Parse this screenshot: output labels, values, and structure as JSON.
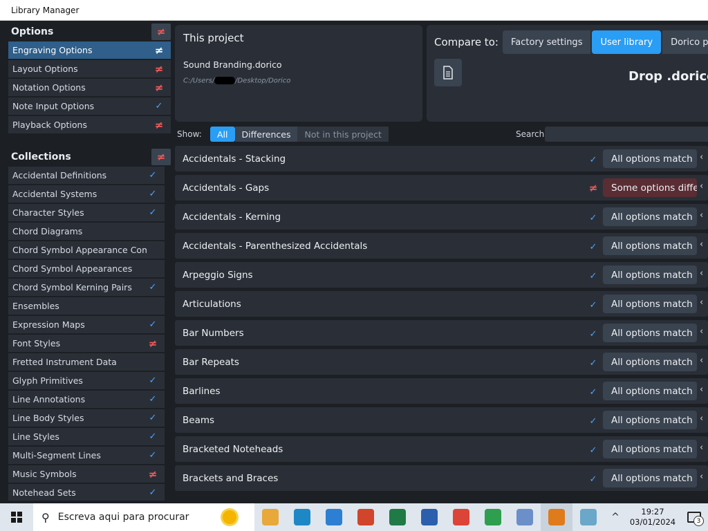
{
  "window": {
    "title": "Library Manager"
  },
  "options_section": {
    "title": "Options",
    "items": [
      {
        "label": "Engraving Options",
        "status": "differ"
      },
      {
        "label": "Layout Options",
        "status": "differ"
      },
      {
        "label": "Notation Options",
        "status": "differ"
      },
      {
        "label": "Note Input Options",
        "status": "match"
      },
      {
        "label": "Playback Options",
        "status": "differ"
      }
    ]
  },
  "collections_section": {
    "title": "Collections",
    "items": [
      {
        "label": "Accidental Definitions",
        "status": "match"
      },
      {
        "label": "Accidental Systems",
        "status": "match"
      },
      {
        "label": "Character Styles",
        "status": "match"
      },
      {
        "label": "Chord Diagrams",
        "status": "none"
      },
      {
        "label": "Chord Symbol Appearance Componen",
        "status": "none"
      },
      {
        "label": "Chord Symbol Appearances",
        "status": "none"
      },
      {
        "label": "Chord Symbol Kerning Pairs",
        "status": "match"
      },
      {
        "label": "Ensembles",
        "status": "none"
      },
      {
        "label": "Expression Maps",
        "status": "match"
      },
      {
        "label": "Font Styles",
        "status": "differ"
      },
      {
        "label": "Fretted Instrument Data",
        "status": "none"
      },
      {
        "label": "Glyph Primitives",
        "status": "match"
      },
      {
        "label": "Line Annotations",
        "status": "match"
      },
      {
        "label": "Line Body Styles",
        "status": "match"
      },
      {
        "label": "Line Styles",
        "status": "match"
      },
      {
        "label": "Multi-Segment Lines",
        "status": "match"
      },
      {
        "label": "Music Symbols",
        "status": "differ"
      },
      {
        "label": "Notehead Sets",
        "status": "match"
      }
    ]
  },
  "project": {
    "title": "This project",
    "file_name": "Sound Branding.dorico",
    "path_prefix": "C:/Users/",
    "path_suffix": "/Desktop/Dorico"
  },
  "compare": {
    "label": "Compare to:",
    "options": [
      "Factory settings",
      "User library",
      "Dorico proje"
    ],
    "selected": "User library",
    "drop_text": "Drop .dorico p"
  },
  "filter": {
    "show_label": "Show:",
    "options": [
      "All",
      "Differences",
      "Not in this project"
    ],
    "selected": "All",
    "search_label": "Search:",
    "search_value": ""
  },
  "rows": [
    {
      "name": "Accidentals - Stacking",
      "status": "match",
      "pill": "All options match"
    },
    {
      "name": "Accidentals - Gaps",
      "status": "differ",
      "pill": "Some options differ"
    },
    {
      "name": "Accidentals - Kerning",
      "status": "match",
      "pill": "All options match"
    },
    {
      "name": "Accidentals - Parenthesized Accidentals",
      "status": "match",
      "pill": "All options match"
    },
    {
      "name": "Arpeggio Signs",
      "status": "match",
      "pill": "All options match"
    },
    {
      "name": "Articulations",
      "status": "match",
      "pill": "All options match"
    },
    {
      "name": "Bar Numbers",
      "status": "match",
      "pill": "All options match"
    },
    {
      "name": "Bar Repeats",
      "status": "match",
      "pill": "All options match"
    },
    {
      "name": "Barlines",
      "status": "match",
      "pill": "All options match"
    },
    {
      "name": "Beams",
      "status": "match",
      "pill": "All options match"
    },
    {
      "name": "Bracketed Noteheads",
      "status": "match",
      "pill": "All options match"
    },
    {
      "name": "Brackets and Braces",
      "status": "match",
      "pill": "All options match"
    }
  ],
  "taskbar": {
    "search_placeholder": "Escreva aqui para procurar",
    "time": "19:27",
    "date": "03/01/2024",
    "notification_count": "3",
    "apps": [
      {
        "icon": "file-explorer-icon",
        "color": "#e8a93a"
      },
      {
        "icon": "edge-icon",
        "color": "#1e88c7"
      },
      {
        "icon": "internet-explorer-icon",
        "color": "#2d7fd3"
      },
      {
        "icon": "powerpoint-icon",
        "color": "#d0452b"
      },
      {
        "icon": "excel-icon",
        "color": "#1f7a45"
      },
      {
        "icon": "word-icon",
        "color": "#2b5fad"
      },
      {
        "icon": "chrome-icon",
        "color": "#db4437"
      },
      {
        "icon": "chrome-profile-icon",
        "color": "#2e9e4f"
      },
      {
        "icon": "paint-icon",
        "color": "#6b8fc9"
      },
      {
        "icon": "dorico-icon",
        "color": "#e07b1c"
      },
      {
        "icon": "notepad-icon",
        "color": "#6aa7c9"
      }
    ],
    "glyphs": {
      "neq": "≠",
      "check": "✓",
      "chevron": "‹",
      "tray_up": "^"
    }
  }
}
